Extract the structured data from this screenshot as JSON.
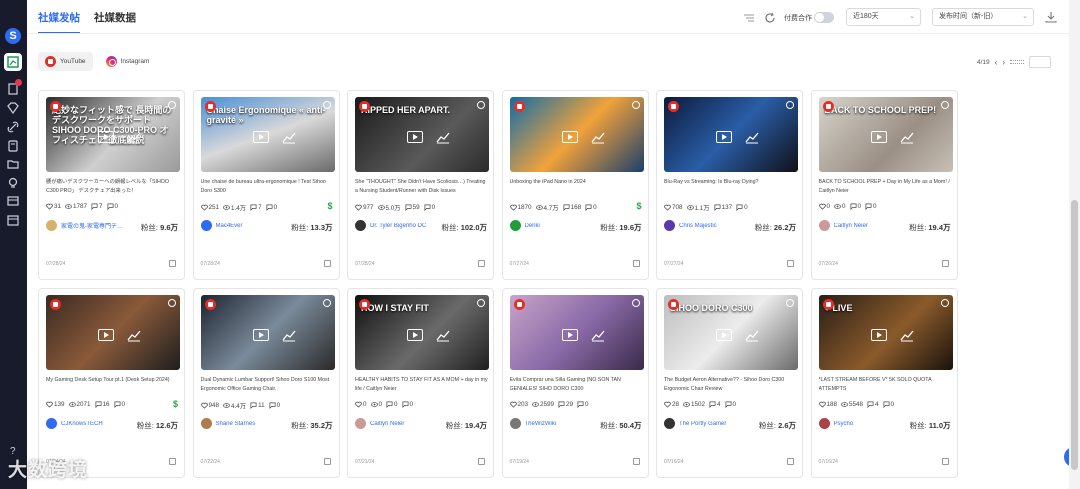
{
  "tabs": [
    {
      "label": "社媒发帖",
      "active": true
    },
    {
      "label": "社媒数据",
      "active": false
    }
  ],
  "toolbar": {
    "coop_label": "付费合作",
    "range_value": "近180天",
    "sort_value": "发布时间（新-旧）",
    "chevron": "⌄"
  },
  "platforms": [
    {
      "label": "YouTube",
      "active": true
    },
    {
      "label": "Instagram",
      "active": false
    }
  ],
  "pager": {
    "text": "4/19",
    "prev": "‹",
    "next": "›"
  },
  "sidebar": {
    "logo": "S",
    "icons": [
      "chart-icon",
      "doc-icon",
      "gem-icon",
      "link-icon",
      "book-icon",
      "folder-icon",
      "bulb-icon",
      "archive-icon",
      "calendar-icon",
      "help-icon",
      "settings-icon"
    ]
  },
  "watermark": "大数跨境",
  "colors": {
    "accent": "#2f6bf1",
    "sidebar": "#181b2b",
    "money": "#22a745",
    "youtube": "#e52d27"
  },
  "cards": [
    {
      "thumb_text": "絶妙なフィット感で 長時間のデスクワークをサポート SIHOO DORO C300-PRO オフィスチェア 徹底解説",
      "title": "腰が痛いデスクワーカーへの朗報レベルな「SIHOO C300 PRO」 デスクチェア出来った！",
      "likes": "31",
      "views": "1787",
      "comments": "7",
      "shares": "0",
      "author": "家電の鬼-家電専門チ…",
      "fans_label": "粉丝:",
      "fans": "9.6万",
      "date": "07/28/24",
      "money": false
    },
    {
      "thumb_text": "Chaise Ergonomique « anti-gravité »",
      "title": "Une chaise de bureau ultra-ergonomique ! Test Sihoo Doro S300",
      "likes": "251",
      "views": "1.4万",
      "comments": "7",
      "shares": "0",
      "author": "Mac4Ever",
      "fans_label": "粉丝:",
      "fans": "13.3万",
      "date": "07/28/24",
      "money": true
    },
    {
      "thumb_text": "RIPPED HER APART.",
      "title": "She \"THOUGHT\" She Didn't Have Scoliosis…) Treating a Nursing Student/Runner with Disk Issues",
      "likes": "977",
      "views": "5.0万",
      "comments": "59",
      "shares": "0",
      "author": "Dr. Tyler Bigenho DC",
      "fans_label": "粉丝:",
      "fans": "102.0万",
      "date": "07/28/24",
      "money": false
    },
    {
      "thumb_text": "",
      "title": "Unboxing the iPad Nano in 2024",
      "likes": "1870",
      "views": "4.7万",
      "comments": "168",
      "shares": "0",
      "author": "Denki",
      "fans_label": "粉丝:",
      "fans": "19.6万",
      "date": "07/27/24",
      "money": true
    },
    {
      "thumb_text": "",
      "title": "Blu-Ray vs Streaming: Is Blu-ray Dying?",
      "likes": "708",
      "views": "1.1万",
      "comments": "137",
      "shares": "0",
      "author": "Chris Majestic",
      "fans_label": "粉丝:",
      "fans": "26.2万",
      "date": "07/27/24",
      "money": false
    },
    {
      "thumb_text": "BACK TO SCHOOL PREP!",
      "title": "BACK TO SCHOOL PREP + Day in My Life as a Mom! / Caitlyn Neier",
      "likes": "0",
      "views": "0",
      "comments": "0",
      "shares": "0",
      "author": "Caitlyn Neier",
      "fans_label": "粉丝:",
      "fans": "19.4万",
      "date": "07/26/24",
      "money": false
    },
    {
      "thumb_text": "",
      "title": "My Gaming Desk Setup Tour pt.1 (Desk Setup 2024)",
      "likes": "139",
      "views": "2071",
      "comments": "16",
      "shares": "0",
      "author": "CJKnowsTECH",
      "fans_label": "粉丝:",
      "fans": "12.6万",
      "date": "07/24/24",
      "money": true
    },
    {
      "thumb_text": "",
      "title": "Dual Dynamic Lumbar Support! Sihoo Doro S100 Most Ergonomic Office Gaming Chair.",
      "likes": "948",
      "views": "4.4万",
      "comments": "11",
      "shares": "0",
      "author": "Shane Starnes",
      "fans_label": "粉丝:",
      "fans": "35.2万",
      "date": "07/22/24",
      "money": false
    },
    {
      "thumb_text": "HOW I STAY FIT",
      "title": "HEALTHY HABITS TO STAY FIT AS A MOM + day in my life / Caitlyn Neier",
      "likes": "0",
      "views": "0",
      "comments": "0",
      "shares": "0",
      "author": "Caitlyn Neier",
      "fans_label": "粉丝:",
      "fans": "19.4万",
      "date": "07/21/24",
      "money": false
    },
    {
      "thumb_text": "",
      "title": "Evita Comprar una Silla Gaming (NO SON TAN GENIALES! SIHO DORO C300",
      "likes": "203",
      "views": "2599",
      "comments": "29",
      "shares": "0",
      "author": "TheWizWiki",
      "fans_label": "粉丝:",
      "fans": "50.4万",
      "date": "07/19/24",
      "money": false
    },
    {
      "thumb_text": "SIHOO DORO C300",
      "title": "The Budget Aeron Alternative?? - Sihoo Doro C300 Ergonomic Chair Review",
      "likes": "28",
      "views": "1502",
      "comments": "4",
      "shares": "0",
      "author": "The Portly Gamer",
      "fans_label": "粉丝:",
      "fans": "2.6万",
      "date": "07/16/24",
      "money": false
    },
    {
      "thumb_text": "● LIVE",
      "title": "*LAST STREAM BEFORE V* 5K SOLO QUOTA ATTEMPTS",
      "likes": "188",
      "views": "5548",
      "comments": "4",
      "shares": "0",
      "author": "Psycho",
      "fans_label": "粉丝:",
      "fans": "11.0万",
      "date": "07/16/24",
      "money": false
    }
  ]
}
